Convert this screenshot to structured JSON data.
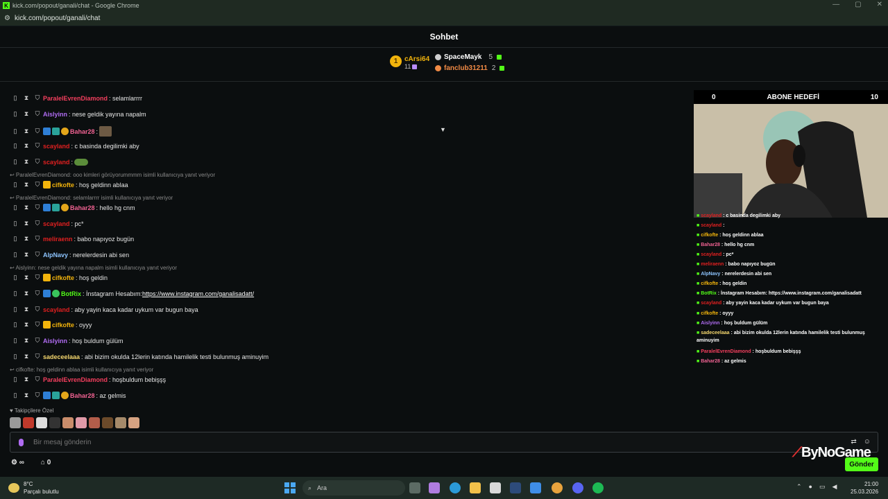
{
  "browser": {
    "title": "kick.com/popout/ganali/chat - Google Chrome",
    "url": "kick.com/popout/ganali/chat"
  },
  "header": {
    "title": "Sohbet"
  },
  "leaderboard": {
    "first": {
      "rank": "1",
      "name": "cArsi64",
      "count": "11"
    },
    "others": [
      {
        "name": "SpaceMayk",
        "count": "5",
        "color": "#ffffff"
      },
      {
        "name": "fanclub31211",
        "count": "2",
        "color": "#f08a45"
      }
    ]
  },
  "messages": [
    {
      "type": "msg",
      "user": "ParalelEvrenDiamond",
      "color": "#f43f5e",
      "text": ": selamlarrrr",
      "badges": []
    },
    {
      "type": "msg",
      "user": "Aislyinn",
      "color": "#b06cf2",
      "text": ": nese geldik yayına napalm",
      "badges": []
    },
    {
      "type": "msg",
      "user": "Bahar28",
      "color": "#f06292",
      "text": ":",
      "badges": [
        "blue",
        "teal",
        "gold"
      ],
      "emote": true
    },
    {
      "type": "msg",
      "user": "scayland",
      "color": "#e02020",
      "text": ": c basinda degilimki aby",
      "badges": []
    },
    {
      "type": "msg",
      "user": "scayland",
      "color": "#e02020",
      "text": ":",
      "badges": [],
      "frog": true
    },
    {
      "type": "reply",
      "text": "ParalelEvrenDiamond: ooo kimleri görüyorummmm isimli kullanıcıya yanıt veriyor"
    },
    {
      "type": "msg",
      "user": "cifkofte",
      "color": "#f2b40c",
      "text": ": hoş geldinn ablaa",
      "badges": [
        "crown"
      ]
    },
    {
      "type": "reply",
      "text": "ParalelEvrenDiamond: selamlarrrr isimli kullanıcıya yanıt veriyor"
    },
    {
      "type": "msg",
      "user": "Bahar28",
      "color": "#f06292",
      "text": ": hello hg cnm",
      "badges": [
        "blue",
        "teal",
        "gold"
      ]
    },
    {
      "type": "msg",
      "user": "scayland",
      "color": "#e02020",
      "text": ": pc*",
      "badges": []
    },
    {
      "type": "msg",
      "user": "meliraenn",
      "color": "#e02020",
      "text": ": babo napıyoz bugün",
      "badges": []
    },
    {
      "type": "msg",
      "user": "AlpNavy",
      "color": "#8ec5ff",
      "text": ": nerelerdesin abi sen",
      "badges": []
    },
    {
      "type": "reply",
      "text": "Aislyinn: nese geldik yayına napalm isimli kullanıcıya yanıt veriyor"
    },
    {
      "type": "msg",
      "user": "cifkofte",
      "color": "#f2b40c",
      "text": ": hoş geldin",
      "badges": [
        "crown"
      ]
    },
    {
      "type": "msg",
      "user": "BotRix",
      "color": "#53fc18",
      "text": ": İnstagram Hesabım: ",
      "badges": [
        "blue",
        "green"
      ],
      "link": "https://www.instagram.com/ganalisadatt/"
    },
    {
      "type": "msg",
      "user": "scayland",
      "color": "#e02020",
      "text": ": aby yayin kaca kadar uykum var bugun baya",
      "badges": []
    },
    {
      "type": "msg",
      "user": "cifkofte",
      "color": "#f2b40c",
      "text": ": oyyy",
      "badges": [
        "crown"
      ]
    },
    {
      "type": "msg",
      "user": "Aislyinn",
      "color": "#b06cf2",
      "text": ": hoş buldum gülüm",
      "badges": []
    },
    {
      "type": "msg",
      "user": "sadeceelaaa",
      "color": "#f5d76e",
      "text": ": abi bizim okulda 12lerin katında hamilelik testi bulunmuş aminuyim",
      "badges": []
    },
    {
      "type": "reply",
      "text": "cifkofte: hoş geldinn ablaa isimli kullanıcıya yanıt veriyor"
    },
    {
      "type": "msg",
      "user": "ParalelEvrenDiamond",
      "color": "#f43f5e",
      "text": ": hoşbuldum bebişşş",
      "badges": []
    },
    {
      "type": "msg",
      "user": "Bahar28",
      "color": "#f06292",
      "text": ": az gelmis",
      "badges": [
        "blue",
        "teal",
        "gold"
      ]
    }
  ],
  "followers_label": "Takipçilere Özel",
  "input": {
    "placeholder": "Bir mesaj gönderin"
  },
  "bottom": {
    "infinity": "∞",
    "count": "0"
  },
  "send_label": "Gönder",
  "goal": {
    "left": "0",
    "title": "ABONE HEDEFİ",
    "right": "10"
  },
  "overlay_chat": [
    {
      "user": "scayland",
      "color": "#e02020",
      "text": " : c basinda degilimki aby"
    },
    {
      "user": "scayland",
      "color": "#e02020",
      "text": " :"
    },
    {
      "user": "cifkofte",
      "color": "#f2b40c",
      "text": " : hoş geldinn ablaa"
    },
    {
      "user": "Bahar28",
      "color": "#f06292",
      "text": " : hello hg cnm"
    },
    {
      "user": "scayland",
      "color": "#e02020",
      "text": " : pc*"
    },
    {
      "user": "meliraenn",
      "color": "#e02020",
      "text": " : babo napıyoz bugün"
    },
    {
      "user": "AlpNavy",
      "color": "#8ec5ff",
      "text": " : nerelerdesin abi sen"
    },
    {
      "user": "cifkofte",
      "color": "#f2b40c",
      "text": " : hoş geldin"
    },
    {
      "user": "BotRix",
      "color": "#53fc18",
      "text": " : İnstagram Hesabım: https://www.instagram.com/ganalisadatt"
    },
    {
      "user": "scayland",
      "color": "#e02020",
      "text": " : aby yayin kaca kadar uykum var bugun baya"
    },
    {
      "user": "cifkofte",
      "color": "#f2b40c",
      "text": " : oyyy"
    },
    {
      "user": "Aislyinn",
      "color": "#b06cf2",
      "text": " : hoş buldum gülüm"
    },
    {
      "user": "sadeceelaaa",
      "color": "#f5d76e",
      "text": " : abi bizim okulda 12lerin katında hamilelik testi bulunmuş"
    },
    {
      "user": "",
      "color": "#ffffff",
      "text": "aminuyim"
    },
    {
      "user": "ParalelEvrenDiamond",
      "color": "#f43f5e",
      "text": " : hoşbuldum bebişşş"
    },
    {
      "user": "Bahar28",
      "color": "#f06292",
      "text": " : az gelmis"
    }
  ],
  "brand": "ByNoGame",
  "taskbar": {
    "weather_temp": "8°C",
    "weather_desc": "Parçalı bulutlu",
    "search_placeholder": "Ara",
    "time": "21:00",
    "date": "25.03.2026"
  },
  "colors": {
    "accent": "#53fc18",
    "background": "#0b0e0f"
  }
}
